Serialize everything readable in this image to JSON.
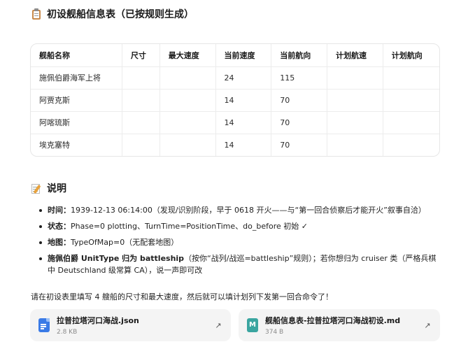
{
  "section1": {
    "title": "初设舰船信息表（已按规则生成）",
    "icon": "clipboard-icon"
  },
  "table": {
    "headers": [
      "舰船名称",
      "尺寸",
      "最大速度",
      "当前速度",
      "当前航向",
      "计划航速",
      "计划航向"
    ],
    "rows": [
      [
        "施佩伯爵海军上将",
        "",
        "",
        "24",
        "115",
        "",
        ""
      ],
      [
        "阿贾克斯",
        "",
        "",
        "14",
        "70",
        "",
        ""
      ],
      [
        "阿喀琉斯",
        "",
        "",
        "14",
        "70",
        "",
        ""
      ],
      [
        "埃克塞特",
        "",
        "",
        "14",
        "70",
        "",
        ""
      ]
    ]
  },
  "section2": {
    "title": "说明",
    "icon": "memo-icon"
  },
  "notes": [
    {
      "label": "时间：",
      "text": "1939-12-13 06:14:00（发现/识别阶段，早于 0618 开火——与“第一回合侦察后才能开火”叙事自洽）"
    },
    {
      "label": "状态：",
      "text": "Phase=0 plotting、TurnTime=PositionTime、do_before 初始 ✓"
    },
    {
      "label": "地图：",
      "text": "TypeOfMap=0（无配套地图）"
    },
    {
      "label": "施佩伯爵 UnitType 归为 battleship",
      "text": "（按你“战列/战巡=battleship”规则）；若你想归为 cruiser 类（严格兵棋中 Deutschland 级常算 CA），说一声即可改"
    }
  ],
  "summary": "请在初设表里填写 4 艘船的尺寸和最大速度，然后就可以填计划列下发第一回合命令了！",
  "files": [
    {
      "name": "拉普拉塔河口海战.json",
      "size": "2.8 KB",
      "icon": "json-file-icon"
    },
    {
      "name": "舰船信息表-拉普拉塔河口海战初设.md",
      "size": "374 B",
      "icon": "markdown-file-icon",
      "glyph": "M"
    }
  ],
  "open_glyph": "↗"
}
